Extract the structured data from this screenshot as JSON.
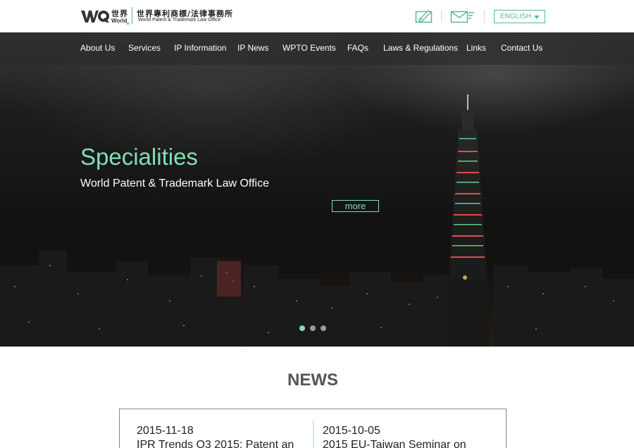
{
  "brand": {
    "logo_cjk": "世界",
    "logo_world": "World",
    "office_name_cjk": "世界專利商標/法律事務所",
    "office_name_en": "World Patent & Trademark Law Office",
    "accent_color": "#5ab98a"
  },
  "toolbar": {
    "icons": [
      "edit-icon",
      "mail-icon"
    ],
    "language": "ENGLISH"
  },
  "nav": {
    "items": [
      "About Us",
      "Services",
      "IP Information",
      "IP News",
      "WPTO Events",
      "FAQs",
      "Laws & Regulations",
      "Links",
      "Contact Us"
    ]
  },
  "hero": {
    "title": "Specialities",
    "subtitle": "World Patent & Trademark Law Office",
    "more_label": "more",
    "title_color": "#7fe0b4",
    "slides": 3,
    "active_slide": 1
  },
  "news": {
    "heading": "NEWS",
    "items": [
      {
        "date": "2015-11-18",
        "title": "IPR Trends Q3 2015: Patent an"
      },
      {
        "date": "2015-10-05",
        "title": "2015 EU-Taiwan Seminar on"
      }
    ]
  }
}
